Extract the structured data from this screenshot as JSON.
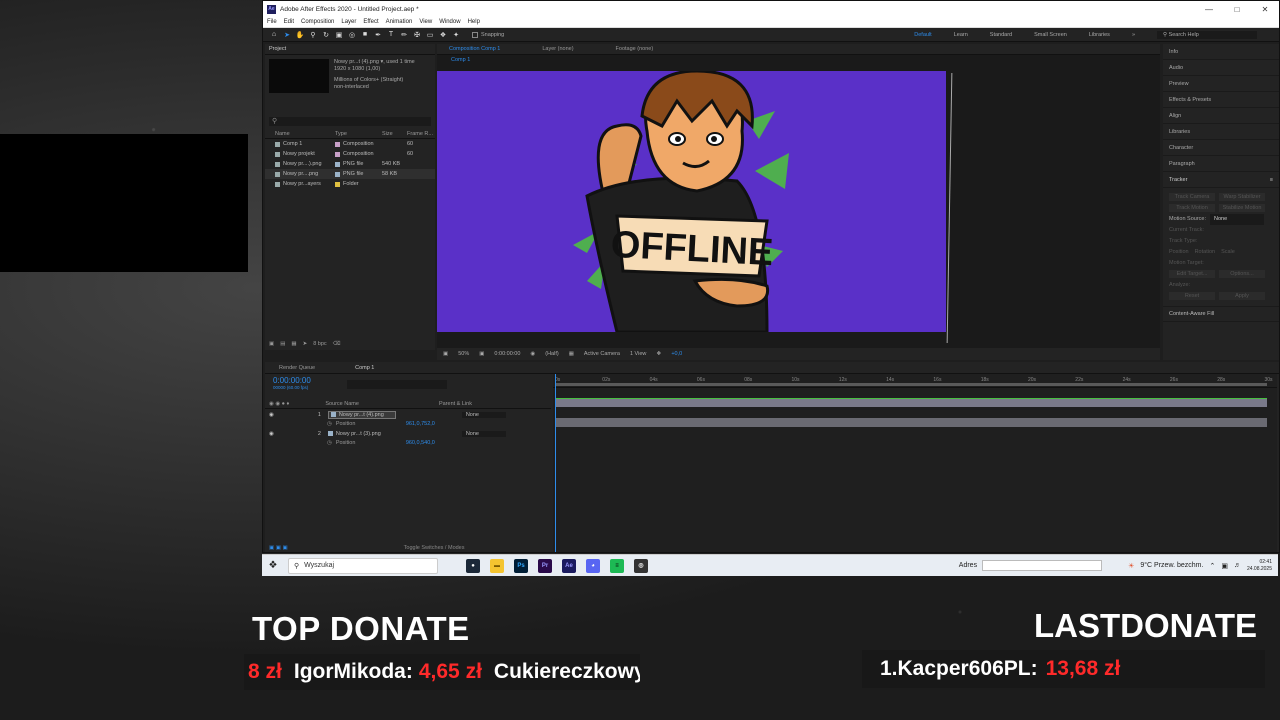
{
  "window": {
    "title": "Adobe After Effects 2020 - Untitled Project.aep *",
    "app_logo": "Ae"
  },
  "menu": [
    "File",
    "Edit",
    "Composition",
    "Layer",
    "Effect",
    "Animation",
    "View",
    "Window",
    "Help"
  ],
  "toolbar": {
    "snapping": "Snapping",
    "workspaces": [
      "Default",
      "Learn",
      "Standard",
      "Small Screen",
      "Libraries"
    ],
    "search": "Search Help"
  },
  "project": {
    "tab": "Project",
    "selected_name": "Nowy pr...t (4).png ▾, used 1 time",
    "selected_dims": "1920 x 1080 (1,00)",
    "selected_colors": "Millions of Colors+ (Straight)",
    "selected_interlace": "non-interlaced",
    "columns": [
      "Name",
      "Type",
      "Size",
      "Frame R..."
    ],
    "items": [
      {
        "name": "Comp 1",
        "type": "Composition",
        "size": "",
        "rate": "60",
        "color": "#c8a0c8"
      },
      {
        "name": "Nowy projekt",
        "type": "Composition",
        "size": "",
        "rate": "60",
        "color": "#c8a0c8"
      },
      {
        "name": "Nowy pr....).png",
        "type": "PNG file",
        "size": "540 KB",
        "rate": "",
        "color": "#9bb3c9"
      },
      {
        "name": "Nowy pr....png",
        "type": "PNG file",
        "size": "58 KB",
        "rate": "",
        "color": "#9bb3c9"
      },
      {
        "name": "Nowy pr...ayers",
        "type": "Folder",
        "size": "",
        "rate": "",
        "color": "#e0c040"
      }
    ],
    "bpc": "8 bpc"
  },
  "composition": {
    "tabs": [
      "Composition Comp 1",
      "Layer (none)",
      "Footage (none)"
    ],
    "sub_tab": "Comp 1",
    "sign_text": "OFFLINE",
    "bottom": {
      "zoom": "50%",
      "time": "0:00:00:00",
      "resolution": "(Half)",
      "camera": "Active Camera",
      "views": "1 View",
      "exposure": "+0,0"
    }
  },
  "right_panels": {
    "items": [
      "Info",
      "Audio",
      "Preview",
      "Effects & Presets",
      "Align",
      "Libraries",
      "Character",
      "Paragraph"
    ],
    "tracker": "Tracker",
    "tracker_buttons": [
      "Track Camera",
      "Warp Stabilizer",
      "Track Motion",
      "Stabilize Motion"
    ],
    "motion_source_label": "Motion Source:",
    "motion_source_value": "None",
    "current_track": "Current Track:",
    "track_type": "Track Type:",
    "position": "Position",
    "rotation": "Rotation",
    "scale": "Scale",
    "motion_target": "Motion Target:",
    "edit_target": "Edit Target...",
    "options": "Options...",
    "analyze": "Analyze:",
    "reset": "Reset",
    "apply": "Apply",
    "content_aware": "Content-Aware Fill"
  },
  "timeline": {
    "tabs": [
      "Render Queue",
      "Comp 1"
    ],
    "timecode": "0:00:00:00",
    "frames": "00000 (60.00 fps)",
    "headers": [
      "Source Name",
      "Parent & Link"
    ],
    "layers": [
      {
        "num": "1",
        "name": "Nowy pr...t (4).png",
        "parent": "None",
        "prop": "Position",
        "value": "961,0,752,0"
      },
      {
        "num": "2",
        "name": "Nowy pr...t (3).png",
        "parent": "None",
        "prop": "Position",
        "value": "960,0,540,0"
      }
    ],
    "footer": "Toggle Switches / Modes",
    "ruler": [
      "0s",
      "02s",
      "04s",
      "06s",
      "08s",
      "10s",
      "12s",
      "14s",
      "16s",
      "18s",
      "20s",
      "22s",
      "24s",
      "26s",
      "28s",
      "30s"
    ]
  },
  "taskbar": {
    "search": "Wyszukaj",
    "apps": [
      {
        "label": "●",
        "bg": "#1b2838",
        "fg": "#ffffff"
      },
      {
        "label": "▬",
        "bg": "#f4c430",
        "fg": "#7a5a00"
      },
      {
        "label": "Ps",
        "bg": "#001e36",
        "fg": "#31a8ff"
      },
      {
        "label": "Pr",
        "bg": "#2a0a4a",
        "fg": "#9999ff"
      },
      {
        "label": "Ae",
        "bg": "#1a1a5e",
        "fg": "#9999ff"
      },
      {
        "label": "◕",
        "bg": "#5865f2",
        "fg": "#ffffff"
      },
      {
        "label": "≡",
        "bg": "#1db954",
        "fg": "#000000"
      },
      {
        "label": "◎",
        "bg": "#333333",
        "fg": "#ffffff"
      }
    ],
    "address_label": "Adres",
    "weather": "9°C  Przew. bezchm.",
    "time": "02:41",
    "date": "24.08.2025"
  },
  "overlay": {
    "top_donate_title": "TOP DONATE",
    "top_donate_entries": [
      {
        "name": "",
        "amount": "8 zł"
      },
      {
        "name": "IgorMikoda:",
        "amount": "4,65 zł"
      },
      {
        "name": "CukiereczkowyA",
        "amount": ""
      }
    ],
    "last_donate_title": "LASTDONATE",
    "last_donate_name": "1.Kacper606PL:",
    "last_donate_amount": "13,68 zł"
  },
  "colors": {
    "accent": "#2d8ceb",
    "canvas_bg": "#5a30c8",
    "donate_red": "#ff2a2a",
    "layer_bar": "#7a7a8a",
    "track_green": "#47c040"
  }
}
